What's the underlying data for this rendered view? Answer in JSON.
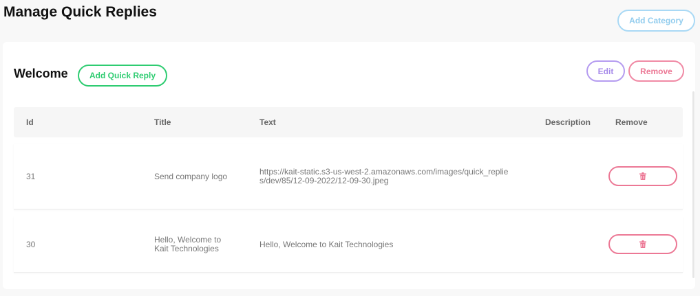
{
  "header": {
    "title": "Manage Quick Replies",
    "add_category_label": "Add Category"
  },
  "category": {
    "title": "Welcome",
    "add_quick_reply_label": "Add Quick Reply",
    "edit_label": "Edit",
    "remove_label": "Remove"
  },
  "table": {
    "columns": [
      "Id",
      "Title",
      "Text",
      "Description",
      "Remove"
    ],
    "rows": [
      {
        "id": "31",
        "title": "Send company logo",
        "text": "https://kait-static.s3-us-west-2.amazonaws.com/images/quick_replies/dev/85/12-09-2022/12-09-30.jpeg",
        "description": ""
      },
      {
        "id": "30",
        "title": "Hello, Welcome to Kait Technologies",
        "text": "Hello, Welcome to Kait Technologies",
        "description": ""
      }
    ]
  },
  "colors": {
    "add_category": "#93cdee",
    "add_quick_reply": "#2ecc71",
    "edit": "#a78bea",
    "remove": "#ec7895"
  },
  "icons": {
    "trash": "trash-icon"
  }
}
